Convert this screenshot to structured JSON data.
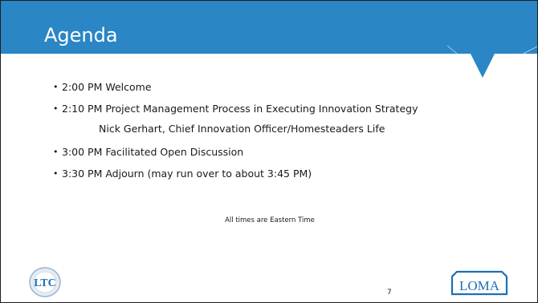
{
  "slide": {
    "title": "Agenda",
    "items": [
      {
        "text": "2:00 PM Welcome"
      },
      {
        "text": "2:10 PM Project Management Process in Executing Innovation Strategy",
        "sub": "Nick Gerhart, Chief Innovation Officer/Homesteaders Life"
      },
      {
        "text": "3:00 PM Facilitated Open Discussion"
      },
      {
        "text": "3:30 PM Adjourn (may run over to about 3:45 PM)"
      }
    ],
    "note": "All times are Eastern Time",
    "page_number": "7",
    "bullet": "•",
    "logos": {
      "left": "LTC",
      "right": "LOMA"
    }
  },
  "colors": {
    "title_bar": "#2a86c4",
    "logo_blue": "#1f6fb5"
  }
}
